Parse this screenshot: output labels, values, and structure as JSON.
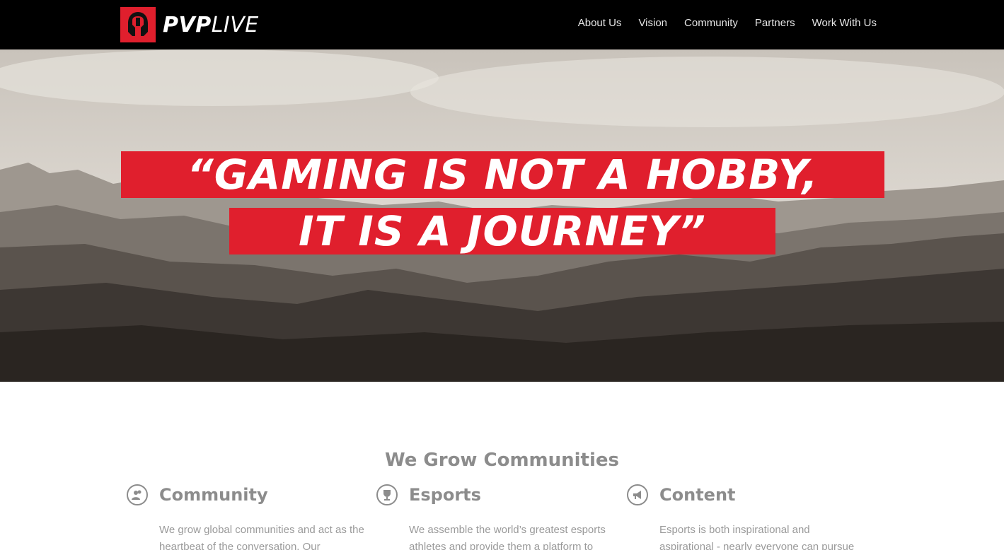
{
  "brand": {
    "name_bold": "PVP",
    "name_light": "LIVE",
    "logo_color": "#e01f2d",
    "logo_icon": "spartan-helmet-icon"
  },
  "nav": {
    "items": [
      "About Us",
      "Vision",
      "Community",
      "Partners",
      "Work With Us"
    ]
  },
  "hero": {
    "line1": "“GAMING IS NOT A HOBBY,",
    "line2": "IT IS A JOURNEY”",
    "banner_color": "#e01f2d"
  },
  "communities": {
    "title": "We Grow Communities",
    "columns": [
      {
        "title": "Community",
        "icon": "community-icon",
        "text": "We grow global communities and act as the heartbeat of the conversation. Our"
      },
      {
        "title": "Esports",
        "icon": "trophy-icon",
        "text": "We assemble the world’s greatest esports athletes and provide them a platform to"
      },
      {
        "title": "Content",
        "icon": "megaphone-icon",
        "text": "Esports is both inspirational and aspirational - nearly everyone can pursue their dreams of"
      }
    ]
  }
}
